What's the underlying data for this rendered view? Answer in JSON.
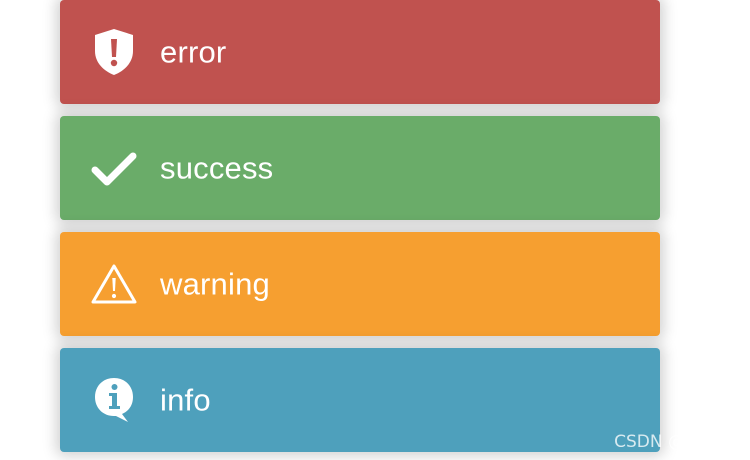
{
  "toasts": [
    {
      "id": "error",
      "message": "error",
      "icon": "shield-exclamation-icon",
      "color": "#c0524f"
    },
    {
      "id": "success",
      "message": "success",
      "icon": "checkmark-icon",
      "color": "#6aac69"
    },
    {
      "id": "warning",
      "message": "warning",
      "icon": "warning-triangle-icon",
      "color": "#f69f30"
    },
    {
      "id": "info",
      "message": "info",
      "icon": "info-speech-bubble-icon",
      "color": "#4ea0bc"
    }
  ],
  "watermark": "CSDN @彭世瑜"
}
